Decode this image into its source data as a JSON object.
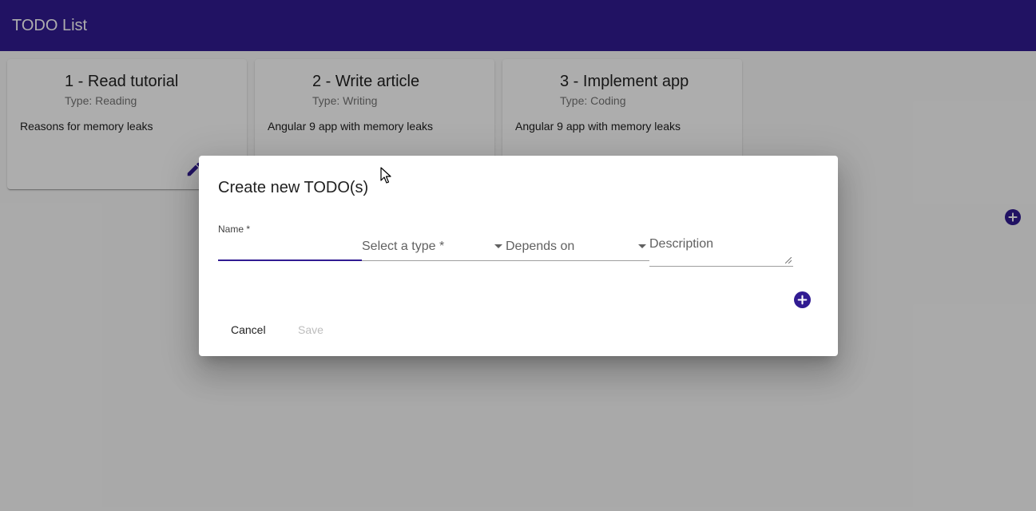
{
  "app": {
    "title": "TODO List",
    "accent_color": "#311b92"
  },
  "cards": [
    {
      "title": "1 - Read tutorial",
      "type_label": "Type: Reading",
      "description": "Reasons for memory leaks"
    },
    {
      "title": "2 - Write article",
      "type_label": "Type: Writing",
      "description": "Angular 9 app with memory leaks"
    },
    {
      "title": "3 - Implement app",
      "type_label": "Type: Coding",
      "description": "Angular 9 app with memory leaks"
    }
  ],
  "dialog": {
    "title": "Create new TODO(s)",
    "fields": {
      "name_label": "Name *",
      "name_value": "",
      "type_placeholder": "Select a type *",
      "depends_placeholder": "Depends on",
      "description_placeholder": "Description"
    },
    "cancel_label": "Cancel",
    "save_label": "Save"
  },
  "icons": {
    "edit": "pencil-icon",
    "add": "add-circle-icon",
    "cursor": "mouse-pointer-icon"
  }
}
